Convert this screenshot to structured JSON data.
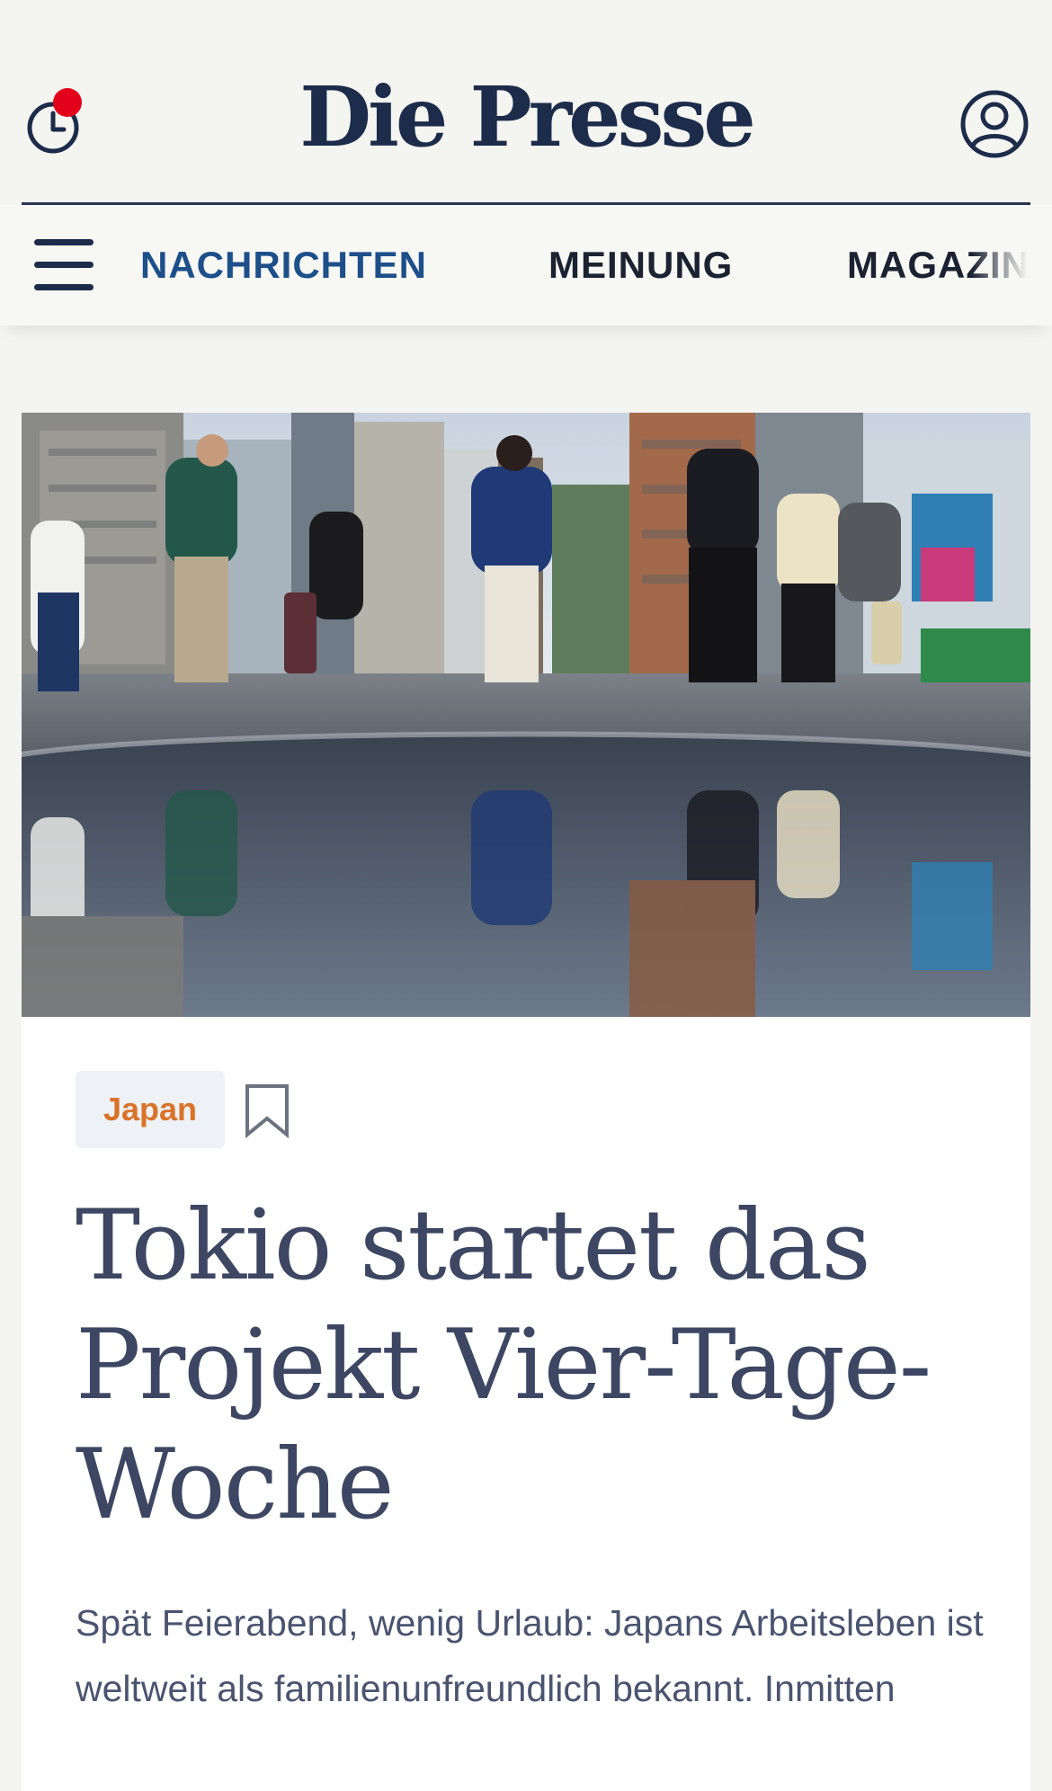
{
  "header": {
    "logo_text": "Die Presse",
    "history_icon": "clock-icon",
    "account_icon": "user-icon",
    "notification_color": "#e3001b"
  },
  "nav": {
    "menu_icon": "hamburger-icon",
    "items": [
      {
        "label": "NACHRICHTEN",
        "active": true
      },
      {
        "label": "MEINUNG",
        "active": false
      },
      {
        "label": "MAGAZIN",
        "active": false
      }
    ]
  },
  "article": {
    "hero_image_alt": "Passanten in Tokio spiegeln sich in einer Pfütze",
    "tag": "Japan",
    "bookmark_icon": "bookmark-icon",
    "headline": "Tokio startet das Projekt Vier-Tage- Woche",
    "lead": "Spät Feierabend, wenig Urlaub: Japans Arbeitsleben ist weltweit als familienunfreundlich bekannt. Inmitten"
  },
  "colors": {
    "brand_navy": "#1c2c4a",
    "nav_active": "#1d4f8a",
    "tag_text": "#d9732a",
    "headline": "#3d4763"
  }
}
